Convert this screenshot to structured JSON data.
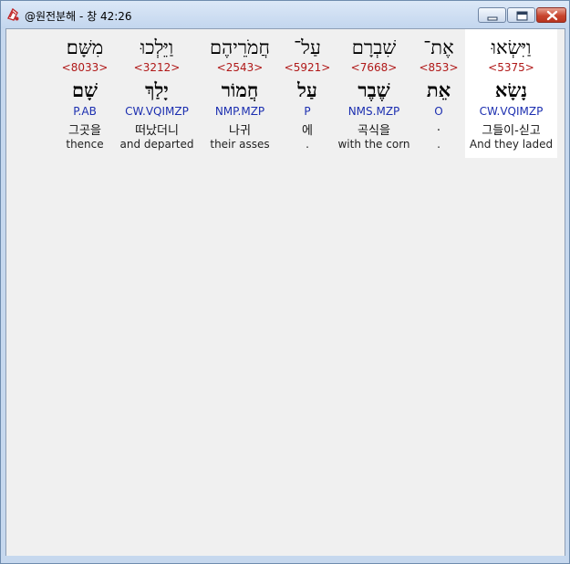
{
  "window": {
    "title": "@원전분해 - 창 42:26",
    "icon": "app-icon"
  },
  "words": [
    {
      "hebrew": "וַיִּשְׂאוּ",
      "strong": "<5375>",
      "lemma": "נָשָׂא",
      "morph": "CW.VQIMZP",
      "korean": "그들이-싣고",
      "english": "And they laded",
      "selected": true
    },
    {
      "hebrew": "אֶת־",
      "strong": "<853>",
      "lemma": "אֵת",
      "morph": "O",
      "korean": ".",
      "english": ".",
      "selected": false
    },
    {
      "hebrew": "שִׁבְרָם",
      "strong": "<7668>",
      "lemma": "שֶׁבֶר",
      "morph": "NMS.MZP",
      "korean": "곡식을",
      "english": "with the corn",
      "selected": false
    },
    {
      "hebrew": "עַל־",
      "strong": "<5921>",
      "lemma": "עַל",
      "morph": "P",
      "korean": "에",
      "english": ".",
      "selected": false
    },
    {
      "hebrew": "חֲמֹרֵיהֶם",
      "strong": "<2543>",
      "lemma": "חֲמוֹר",
      "morph": "NMP.MZP",
      "korean": "나귀",
      "english": "their asses",
      "selected": false
    },
    {
      "hebrew": "וַיֵּלְכוּ",
      "strong": "<3212>",
      "lemma": "יָלַךְ",
      "morph": "CW.VQIMZP",
      "korean": "떠났더니",
      "english": "and departed",
      "selected": false
    },
    {
      "hebrew": "מִשָּׁם׃",
      "strong": "<8033>",
      "lemma": "שָׁם",
      "morph": "P.AB",
      "korean": "그곳을",
      "english": "thence",
      "selected": false
    }
  ]
}
